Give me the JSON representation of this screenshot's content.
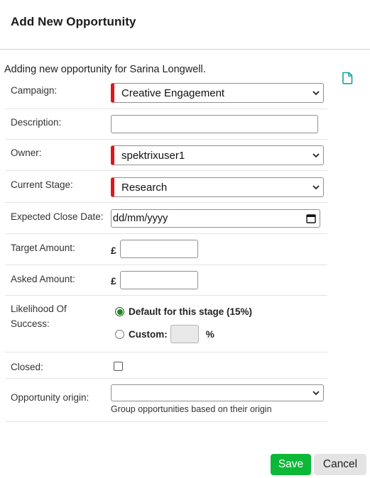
{
  "header": {
    "title": "Add New Opportunity"
  },
  "intro": "Adding new opportunity for Sarina Longwell.",
  "icons": {
    "note": "note-icon",
    "dropdown": "chevron-down-icon",
    "date": "calendar-icon"
  },
  "colors": {
    "required": "#e0161b",
    "save": "#0cb936",
    "cancel": "#e4e4e4",
    "radio_selected": "#1e8a1e",
    "note_icon": "#15a3a3"
  },
  "form": {
    "campaign": {
      "label": "Campaign:",
      "value": "Creative Engagement"
    },
    "description": {
      "label": "Description:",
      "value": ""
    },
    "owner": {
      "label": "Owner:",
      "value": "spektrixuser1"
    },
    "stage": {
      "label": "Current Stage:",
      "value": "Research"
    },
    "close_date": {
      "label": "Expected Close Date:",
      "placeholder": "dd/mm/yyyy"
    },
    "target": {
      "label": "Target Amount:",
      "currency": "£",
      "value": ""
    },
    "asked": {
      "label": "Asked Amount:",
      "currency": "£",
      "value": ""
    },
    "likelihood": {
      "label_line1": "Likelihood Of",
      "label_line2": "Success:",
      "default_option": "Default for this stage (15%)",
      "custom_option": "Custom:",
      "custom_value": "",
      "percent": "%"
    },
    "closed": {
      "label": "Closed:",
      "checked": false
    },
    "origin": {
      "label": "Opportunity origin:",
      "value": "",
      "hint": "Group opportunities based on their origin"
    }
  },
  "buttons": {
    "save": "Save",
    "cancel": "Cancel"
  }
}
